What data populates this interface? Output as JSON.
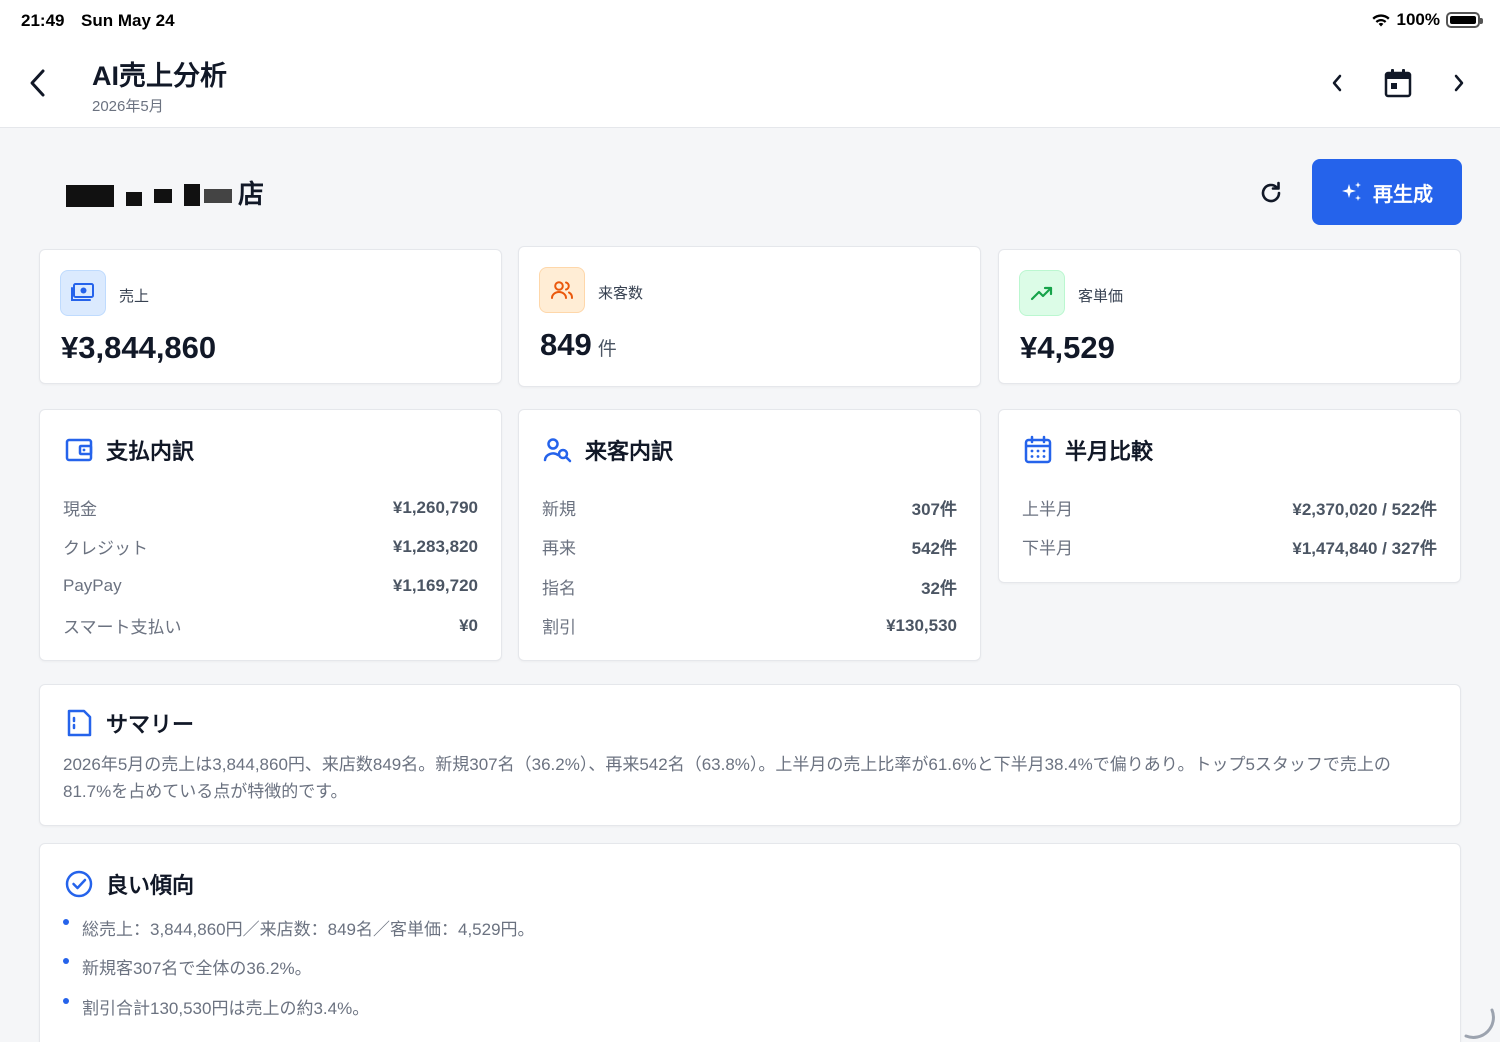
{
  "status_bar": {
    "time": "21:49",
    "date": "Sun May 24",
    "battery": "100%"
  },
  "header": {
    "title": "AI売上分析",
    "subtitle": "2026年5月"
  },
  "store": {
    "name_suffix": "店"
  },
  "actions": {
    "regenerate_label": "再生成"
  },
  "colors": {
    "accent": "#2563eb",
    "sales_icon_bg": "#dbeafe",
    "visitors_icon_bg": "#ffedd5",
    "visitors_icon": "#ea580c",
    "avg_icon_bg": "#dcfce7",
    "avg_icon": "#16a34a"
  },
  "kpis": [
    {
      "label": "売上",
      "value": "¥3,844,860",
      "unit": "",
      "icon": "money-icon"
    },
    {
      "label": "来客数",
      "value": "849",
      "unit": "件",
      "icon": "users-icon"
    },
    {
      "label": "客単価",
      "value": "¥4,529",
      "unit": "",
      "icon": "trending-up-icon"
    }
  ],
  "payment": {
    "title": "支払内訳",
    "rows": [
      {
        "label": "現金",
        "value": "¥1,260,790"
      },
      {
        "label": "クレジット",
        "value": "¥1,283,820"
      },
      {
        "label": "PayPay",
        "value": "¥1,169,720"
      },
      {
        "label": "スマート支払い",
        "value": "¥0"
      }
    ]
  },
  "visitors": {
    "title": "来客内訳",
    "rows": [
      {
        "label": "新規",
        "value": "307件"
      },
      {
        "label": "再来",
        "value": "542件"
      },
      {
        "label": "指名",
        "value": "32件"
      },
      {
        "label": "割引",
        "value": "¥130,530"
      }
    ]
  },
  "half": {
    "title": "半月比較",
    "rows": [
      {
        "label": "上半月",
        "value": "¥2,370,020 / 522件"
      },
      {
        "label": "下半月",
        "value": "¥1,474,840 / 327件"
      }
    ]
  },
  "summary": {
    "title": "サマリー",
    "text": "2026年5月の売上は3,844,860円、来店数849名。新規307名（36.2%）、再来542名（63.8%）。上半月の売上比率が61.6%と下半月38.4%で偏りあり。トップ5スタッフで売上の81.7%を占めている点が特徴的です。"
  },
  "good_trends": {
    "title": "良い傾向",
    "items": [
      "総売上：3,844,860円／来店数：849名／客単価：4,529円。",
      "新規客307名で全体の36.2%。",
      "割引合計130,530円は売上の約3.4%。"
    ]
  }
}
